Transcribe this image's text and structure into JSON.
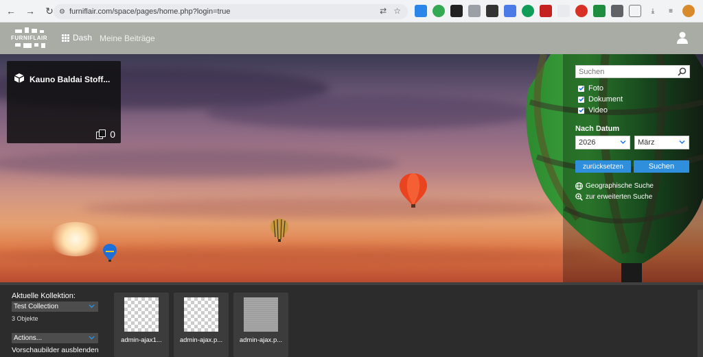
{
  "browser": {
    "url": "furniflair.com/space/pages/home.php?login=true"
  },
  "header": {
    "logo_text": "FURNIFLAIR",
    "nav_dash": "Dash",
    "nav_beitraege": "Meine Beiträge"
  },
  "featured_collection": {
    "title": "Kauno Baldai Stoff...",
    "count": "0"
  },
  "search": {
    "placeholder": "Suchen",
    "filters": [
      {
        "label": "Foto",
        "checked": true
      },
      {
        "label": "Dokument",
        "checked": true
      },
      {
        "label": "Video",
        "checked": true
      }
    ],
    "date_label": "Nach Datum",
    "year": "2026",
    "month": "März",
    "reset_label": "zurücksetzen",
    "search_label": "Suchen",
    "geo_search": "Geographische Suche",
    "advanced_search": "zur erweiterten Suche"
  },
  "collection_bar": {
    "current_label": "Aktuelle Kollektion:",
    "selected_collection": "Test Collection",
    "object_count": "3 Objekte",
    "actions_label": "Actions...",
    "hide_previews": "Vorschaubilder ausblenden",
    "items": [
      {
        "caption": "admin-ajax1..."
      },
      {
        "caption": "admin-ajax.p..."
      },
      {
        "caption": "admin-ajax.p..."
      }
    ]
  }
}
